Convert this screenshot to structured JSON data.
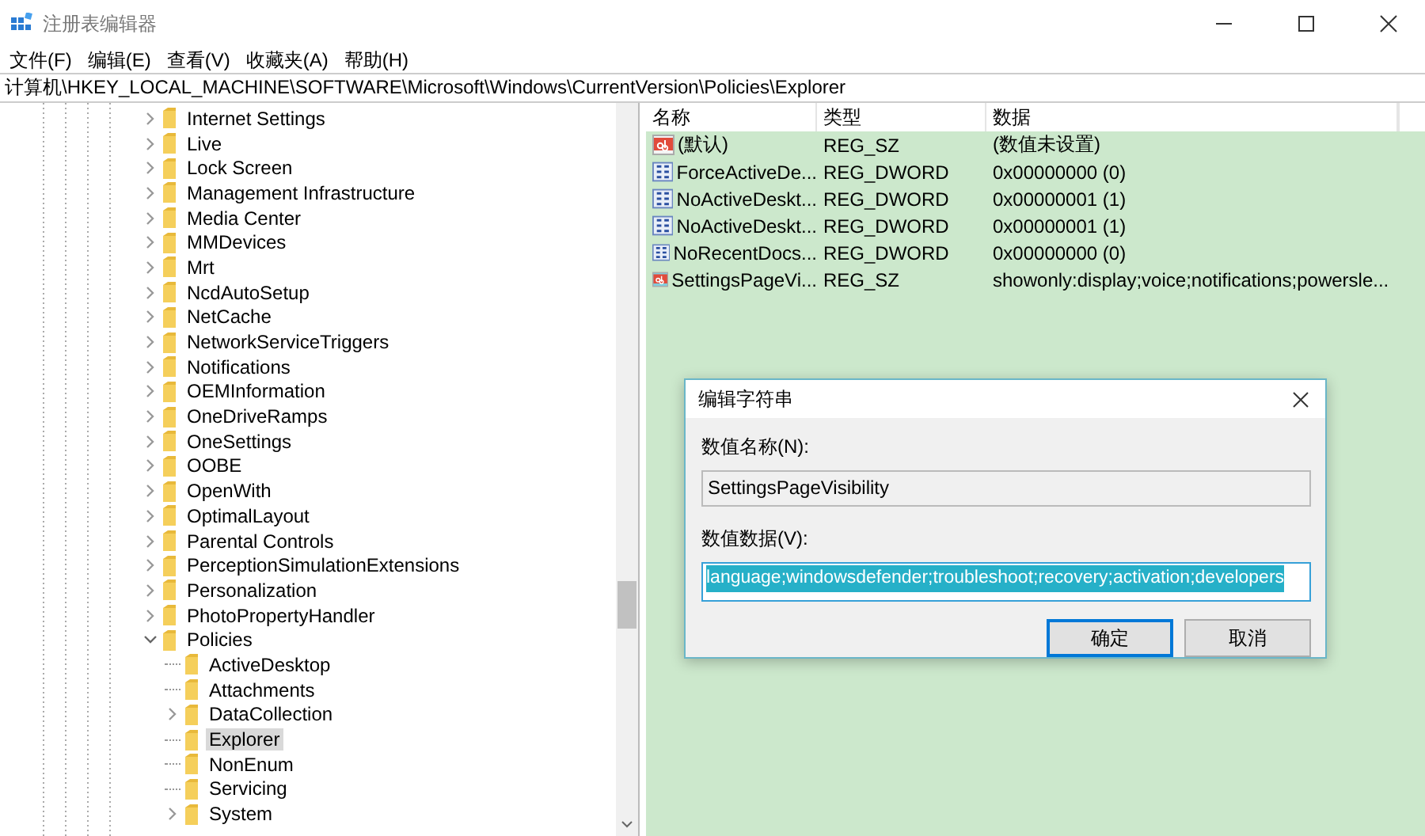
{
  "window": {
    "title": "注册表编辑器"
  },
  "menu": [
    "文件(F)",
    "编辑(E)",
    "查看(V)",
    "收藏夹(A)",
    "帮助(H)"
  ],
  "address": "计算机\\HKEY_LOCAL_MACHINE\\SOFTWARE\\Microsoft\\Windows\\CurrentVersion\\Policies\\Explorer",
  "tree": [
    {
      "label": "Internet Settings",
      "expanded": false,
      "selected": false
    },
    {
      "label": "Live",
      "expanded": false,
      "selected": false
    },
    {
      "label": "Lock Screen",
      "expanded": false,
      "selected": false
    },
    {
      "label": "Management Infrastructure",
      "expanded": false,
      "selected": false
    },
    {
      "label": "Media Center",
      "expanded": false,
      "selected": false
    },
    {
      "label": "MMDevices",
      "expanded": false,
      "selected": false
    },
    {
      "label": "Mrt",
      "expanded": false,
      "selected": false
    },
    {
      "label": "NcdAutoSetup",
      "expanded": false,
      "selected": false
    },
    {
      "label": "NetCache",
      "expanded": false,
      "selected": false
    },
    {
      "label": "NetworkServiceTriggers",
      "expanded": false,
      "selected": false
    },
    {
      "label": "Notifications",
      "expanded": false,
      "selected": false
    },
    {
      "label": "OEMInformation",
      "expanded": false,
      "selected": false
    },
    {
      "label": "OneDriveRamps",
      "expanded": false,
      "selected": false
    },
    {
      "label": "OneSettings",
      "expanded": false,
      "selected": false
    },
    {
      "label": "OOBE",
      "expanded": false,
      "selected": false
    },
    {
      "label": "OpenWith",
      "expanded": false,
      "selected": false
    },
    {
      "label": "OptimalLayout",
      "expanded": false,
      "selected": false
    },
    {
      "label": "Parental Controls",
      "expanded": false,
      "selected": false
    },
    {
      "label": "PerceptionSimulationExtensions",
      "expanded": false,
      "selected": false
    },
    {
      "label": "Personalization",
      "expanded": false,
      "selected": false
    },
    {
      "label": "PhotoPropertyHandler",
      "expanded": false,
      "selected": false
    },
    {
      "label": "Policies",
      "expanded": true,
      "selected": false,
      "children": [
        {
          "label": "ActiveDesktop",
          "selected": false
        },
        {
          "label": "Attachments",
          "selected": false
        },
        {
          "label": "DataCollection",
          "expanded": false,
          "selected": false
        },
        {
          "label": "Explorer",
          "selected": true
        },
        {
          "label": "NonEnum",
          "selected": false
        },
        {
          "label": "Servicing",
          "selected": false
        },
        {
          "label": "System",
          "expanded": false,
          "selected": false
        }
      ]
    }
  ],
  "values": {
    "columns": [
      "名称",
      "类型",
      "数据"
    ],
    "rows": [
      {
        "kind": "string",
        "name": "(默认)",
        "type": "REG_SZ",
        "data": "(数值未设置)"
      },
      {
        "kind": "dword",
        "name": "ForceActiveDe...",
        "type": "REG_DWORD",
        "data": "0x00000000 (0)"
      },
      {
        "kind": "dword",
        "name": "NoActiveDeskt...",
        "type": "REG_DWORD",
        "data": "0x00000001 (1)"
      },
      {
        "kind": "dword",
        "name": "NoActiveDeskt...",
        "type": "REG_DWORD",
        "data": "0x00000001 (1)"
      },
      {
        "kind": "dword",
        "name": "NoRecentDocs...",
        "type": "REG_DWORD",
        "data": "0x00000000 (0)"
      },
      {
        "kind": "string",
        "name": "SettingsPageVi...",
        "type": "REG_SZ",
        "data": "showonly:display;voice;notifications;powersle..."
      }
    ]
  },
  "dialog": {
    "title": "编辑字符串",
    "name_label": "数值名称(N):",
    "name_value": "SettingsPageVisibility",
    "data_label": "数值数据(V):",
    "data_value": "language;windowsdefender;troubleshoot;recovery;activation;developers",
    "buttons": [
      {
        "label": "确定",
        "default": true
      },
      {
        "label": "取消",
        "default": false
      }
    ]
  }
}
